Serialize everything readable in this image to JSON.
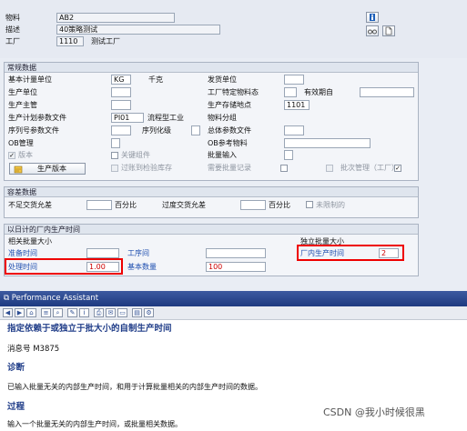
{
  "header": {
    "material_label": "物料",
    "material_value": "AB2",
    "desc_label": "描述",
    "desc_value": "40策略测试",
    "plant_label": "工厂",
    "plant_value": "1110",
    "plant_desc": "测试工厂"
  },
  "general": {
    "title": "常规数据",
    "base_uom_label": "基本计量单位",
    "base_uom_value": "KG",
    "base_uom_desc": "千克",
    "issue_unit_label": "发货单位",
    "prod_unit_label": "生产单位",
    "plant_status_label": "工厂特定物料态",
    "valid_from_label": "有效期自",
    "prod_sup_label": "生产主管",
    "prod_storage_label": "生产存储地点",
    "prod_storage_value": "1101",
    "prod_profile_label": "生产计划参数文件",
    "prod_profile_value": "PI01",
    "prod_profile_desc": "流程型工业",
    "mat_group_label": "物料分组",
    "serial_label": "序列号参数文件",
    "serial_level_label": "序列化级",
    "overall_profile_label": "总体参数文件",
    "ob_mgmt_label": "OB管理",
    "ob_ref_label": "OB参考物料",
    "version_label": "版本",
    "batch_input_label": "批量输入",
    "prod_version_btn": "生产版本",
    "key_comp_label": "关键组件",
    "batch_record_label": "需要批量记录",
    "batch_mgmt_label": "批次管理（工厂）",
    "over_insp_label": "过账到检验库存"
  },
  "tolerance": {
    "title": "容差数据",
    "under_label": "不足交货允差",
    "under_unit": "百分比",
    "over_label": "过度交货允差",
    "over_unit": "百分比",
    "unlimited_label": "未限制的"
  },
  "inhouse": {
    "title": "以日计的厂内生产时间",
    "lot_dep_label": "相关批量大小",
    "lot_indep_label": "独立批量大小",
    "setup_label": "准备时间",
    "interop_label": "工序间",
    "inhouse_label": "厂内生产时间",
    "inhouse_value": "2",
    "processing_label": "处理时间",
    "processing_value": "1.00",
    "base_qty_label": "基本数量",
    "base_qty_value": "100"
  },
  "pa": {
    "title": "Performance Assistant",
    "heading": "指定依赖于或独立于批大小的自制生产时间",
    "msg_no": "消息号 M3875",
    "diag_title": "诊断",
    "diag_text": "已输入批量无关的内部生产时间，和用于计算批量相关的内部生产时间的数据。",
    "proc_title": "过程",
    "proc_text": "输入一个批量无关的内部生产时间，或批量相关数据。"
  },
  "watermark": "CSDN @我小时候很黑"
}
